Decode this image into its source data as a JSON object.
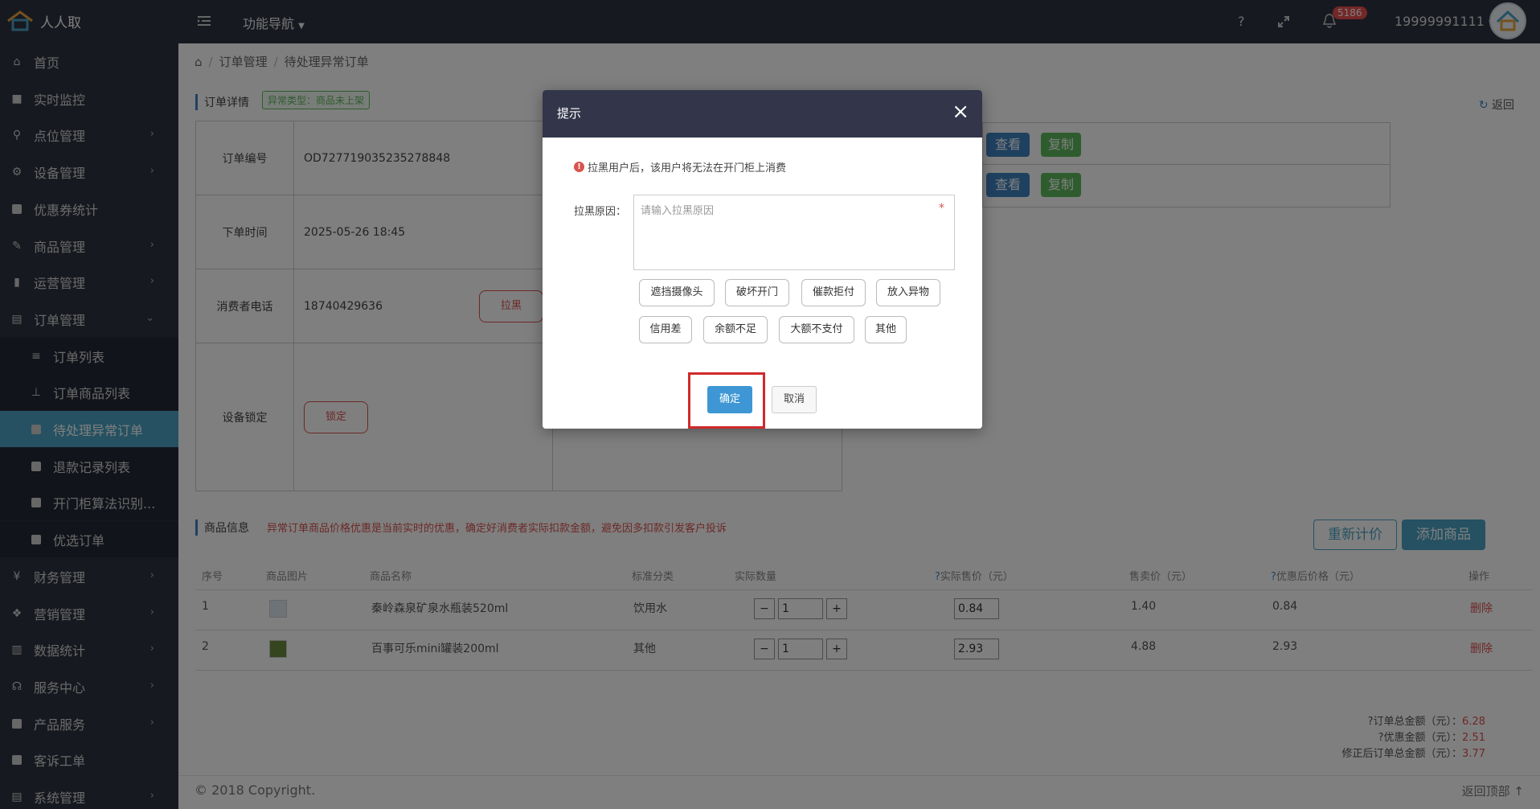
{
  "app": {
    "name": "人人取",
    "func_nav": "功能导航"
  },
  "header": {
    "help": "?",
    "notif_count": "5186",
    "user": "19999991111"
  },
  "sidebar": {
    "items": [
      {
        "label": "首页",
        "icon": "home-icon",
        "glyph": "⌂",
        "chevron": false
      },
      {
        "label": "实时监控",
        "icon": "video-icon",
        "glyph": "■",
        "chevron": false
      },
      {
        "label": "点位管理",
        "icon": "map-pin-icon",
        "glyph": "⚲",
        "chevron": true
      },
      {
        "label": "设备管理",
        "icon": "device-icon",
        "glyph": "⚙",
        "chevron": true
      },
      {
        "label": "优惠券统计",
        "icon": "square-icon",
        "glyph": "",
        "chevron": false
      },
      {
        "label": "商品管理",
        "icon": "edit-icon",
        "glyph": "✎",
        "chevron": true
      },
      {
        "label": "运营管理",
        "icon": "bookmark-icon",
        "glyph": "▮",
        "chevron": true
      },
      {
        "label": "订单管理",
        "icon": "list-icon",
        "glyph": "▤",
        "chevron": true,
        "open": true
      },
      {
        "label": "订单列表",
        "icon": "bars-icon",
        "glyph": "≡",
        "sub": true
      },
      {
        "label": "订单商品列表",
        "icon": "sitemap-icon",
        "glyph": "⊥",
        "sub": true
      },
      {
        "label": "待处理异常订单",
        "icon": "square-icon",
        "glyph": "",
        "sub": true,
        "active": true
      },
      {
        "label": "退款记录列表",
        "icon": "square-icon",
        "glyph": "",
        "sub": true
      },
      {
        "label": "开门柜算法识别...",
        "icon": "square-icon",
        "glyph": "",
        "sub": true
      },
      {
        "label": "优选订单",
        "icon": "square-icon",
        "glyph": "",
        "sub": true
      },
      {
        "label": "财务管理",
        "icon": "yen-icon",
        "glyph": "¥",
        "chevron": true
      },
      {
        "label": "营销管理",
        "icon": "gift-icon",
        "glyph": "❖",
        "chevron": true
      },
      {
        "label": "数据统计",
        "icon": "chart-icon",
        "glyph": "▥",
        "chevron": true
      },
      {
        "label": "服务中心",
        "icon": "headset-icon",
        "glyph": "☊",
        "chevron": true
      },
      {
        "label": "产品服务",
        "icon": "square-icon",
        "glyph": "",
        "chevron": true
      },
      {
        "label": "客诉工单",
        "icon": "square-icon",
        "glyph": "",
        "chevron": false
      },
      {
        "label": "系统管理",
        "icon": "list-icon",
        "glyph": "▤",
        "chevron": true
      }
    ]
  },
  "breadcrumb": {
    "level1": "订单管理",
    "level2": "待处理异常订单"
  },
  "detail": {
    "section_title": "订单详情",
    "anomaly_tag": "异常类型：商品未上架",
    "back": "返回",
    "rows": {
      "order_no_label": "订单编号",
      "order_no": "OD727719035235278848",
      "time_label": "下单时间",
      "time": "2025-05-26 18:45",
      "phone_label": "消费者电话",
      "phone": "18740429636",
      "blacklist_btn": "拉黑",
      "lock_label": "设备锁定",
      "lock_btn": "锁定"
    },
    "view_btn": "查看",
    "copy_btn": "复制"
  },
  "goods": {
    "section_title": "商品信息",
    "warning": "异常订单商品价格优惠是当前实时的优惠，确定好消费者实际扣款金额，避免因多扣款引发客户投诉",
    "reprice_btn": "重新计价",
    "add_btn": "添加商品",
    "headers": [
      "序号",
      "商品图片",
      "商品名称",
      "标准分类",
      "实际数量",
      "实际售价（元）",
      "售卖价（元）",
      "优惠后价格（元）",
      "操作"
    ],
    "rows": [
      {
        "idx": "1",
        "name": "秦岭森泉矿泉水瓶装520ml",
        "cat": "饮用水",
        "qty": "1",
        "price": "0.84",
        "sale": "1.40",
        "disc": "0.84",
        "op": "删除"
      },
      {
        "idx": "2",
        "name": "百事可乐mini罐装200ml",
        "cat": "其他",
        "qty": "1",
        "price": "2.93",
        "sale": "4.88",
        "disc": "2.93",
        "op": "删除"
      }
    ]
  },
  "totals": {
    "total_label": "订单总金额（元）：",
    "total": "6.28",
    "discount_label": "优惠金额（元）：",
    "discount": "2.51",
    "final_label": "修正后订单总金额（元）：",
    "final": "3.77"
  },
  "footer": {
    "copyright": "© 2018 Copyright.",
    "back_top": "返回顶部"
  },
  "modal": {
    "title": "提示",
    "close": "×",
    "tip": "拉黑用户后，该用户将无法在开门柜上消费",
    "reason_label": "拉黑原因：",
    "reason_placeholder": "请输入拉黑原因",
    "required_mark": "*",
    "chips": [
      "遮挡摄像头",
      "破坏开门",
      "催款拒付",
      "放入异物",
      "信用差",
      "余额不足",
      "大额不支付",
      "其他"
    ],
    "confirm": "确定",
    "cancel": "取消"
  }
}
